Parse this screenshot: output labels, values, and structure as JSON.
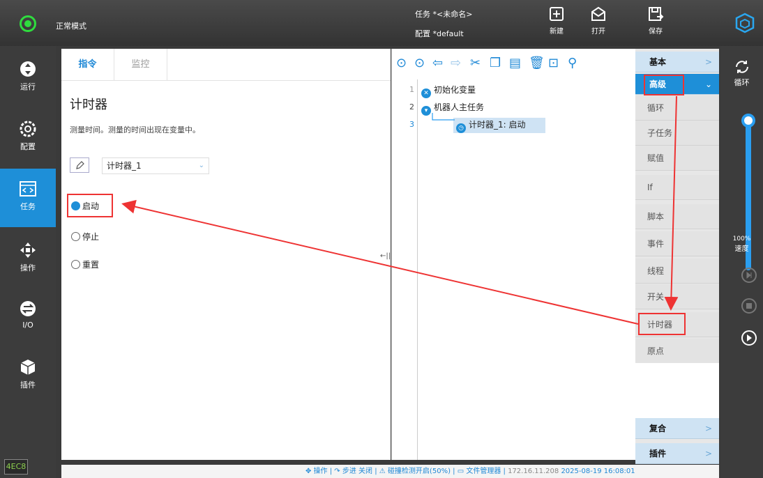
{
  "header": {
    "mode": "正常模式",
    "task": "任务  *<未命名>",
    "config": "配置  *default",
    "new_label": "新建",
    "open_label": "打开",
    "save_label": "保存"
  },
  "left_nav": {
    "items": [
      {
        "label": "运行",
        "icon": "run-icon"
      },
      {
        "label": "配置",
        "icon": "config-icon"
      },
      {
        "label": "任务",
        "icon": "task-icon"
      },
      {
        "label": "操作",
        "icon": "move-icon"
      },
      {
        "label": "I/O",
        "icon": "io-icon"
      },
      {
        "label": "插件",
        "icon": "plugin-icon"
      }
    ],
    "version": "4EC8"
  },
  "instruction_panel": {
    "tab_instruction": "指令",
    "tab_monitor": "监控",
    "title": "计时器",
    "description": "测量时间。测量的时间出现在变量中。",
    "timer_select": "计时器_1",
    "options": [
      "启动",
      "停止",
      "重置"
    ],
    "selected_option": "启动"
  },
  "code_panel": {
    "lines": [
      {
        "num": "1",
        "text": "初始化变量"
      },
      {
        "num": "2",
        "text": "机器人主任务"
      },
      {
        "num": "3",
        "text": "计时器_1: 启动"
      }
    ]
  },
  "category_panel": {
    "basic": "基本",
    "advanced": "高级",
    "advanced_items": [
      "循环",
      "子任务",
      "赋值",
      "If",
      "脚本",
      "事件",
      "线程",
      "开关",
      "计时器",
      "原点"
    ],
    "composite": "复合",
    "plugin": "插件"
  },
  "right_panel": {
    "loop_label": "循环",
    "speed_value": "100%",
    "speed_label": "速度",
    "speed_level": 1.0
  },
  "status_bar": {
    "operation": "操作",
    "step": "步进 关闭",
    "collision": "碰撞检测开启(50%)",
    "file_manager": "文件管理器",
    "ip": "172.16.11.208",
    "datetime": "2025-08-19 16:08:01"
  },
  "colors": {
    "accent": "#1e8fd8",
    "highlight": "#e33333",
    "status_green": "#2fdc3e"
  }
}
